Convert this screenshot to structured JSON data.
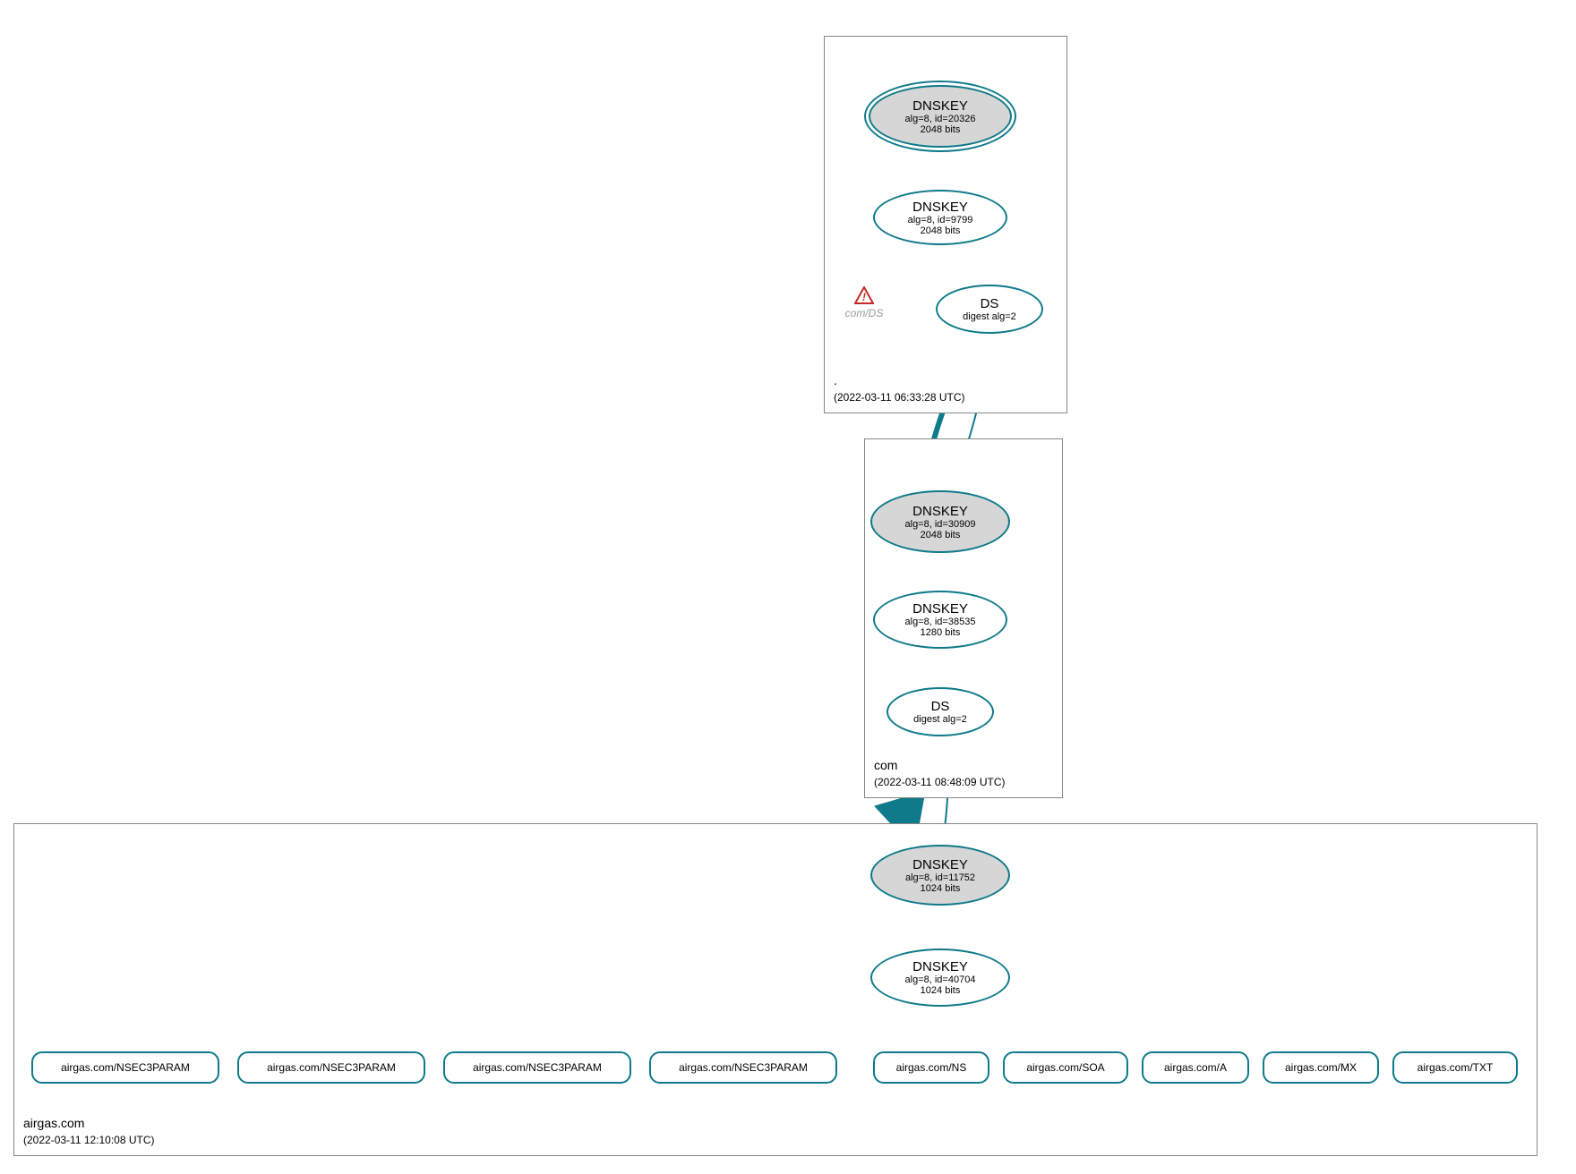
{
  "zones": {
    "root": {
      "label": ".",
      "date": "(2022-03-11 06:33:28 UTC)"
    },
    "com": {
      "label": "com",
      "date": "(2022-03-11 08:48:09 UTC)"
    },
    "airgas": {
      "label": "airgas.com",
      "date": "(2022-03-11 12:10:08 UTC)"
    }
  },
  "nodes": {
    "root_ksk": {
      "t": "DNSKEY",
      "l2": "alg=8, id=20326",
      "l3": "2048 bits"
    },
    "root_zsk": {
      "t": "DNSKEY",
      "l2": "alg=8, id=9799",
      "l3": "2048 bits"
    },
    "root_ds": {
      "t": "DS",
      "l2": "digest alg=2"
    },
    "com_ksk": {
      "t": "DNSKEY",
      "l2": "alg=8, id=30909",
      "l3": "2048 bits"
    },
    "com_zsk": {
      "t": "DNSKEY",
      "l2": "alg=8, id=38535",
      "l3": "1280 bits"
    },
    "com_ds": {
      "t": "DS",
      "l2": "digest alg=2"
    },
    "air_ksk": {
      "t": "DNSKEY",
      "l2": "alg=8, id=11752",
      "l3": "1024 bits"
    },
    "air_zsk": {
      "t": "DNSKEY",
      "l2": "alg=8, id=40704",
      "l3": "1024 bits"
    }
  },
  "rr": [
    "airgas.com/NSEC3PARAM",
    "airgas.com/NSEC3PARAM",
    "airgas.com/NSEC3PARAM",
    "airgas.com/NSEC3PARAM",
    "airgas.com/NS",
    "airgas.com/SOA",
    "airgas.com/A",
    "airgas.com/MX",
    "airgas.com/TXT"
  ],
  "warn": "com/DS"
}
